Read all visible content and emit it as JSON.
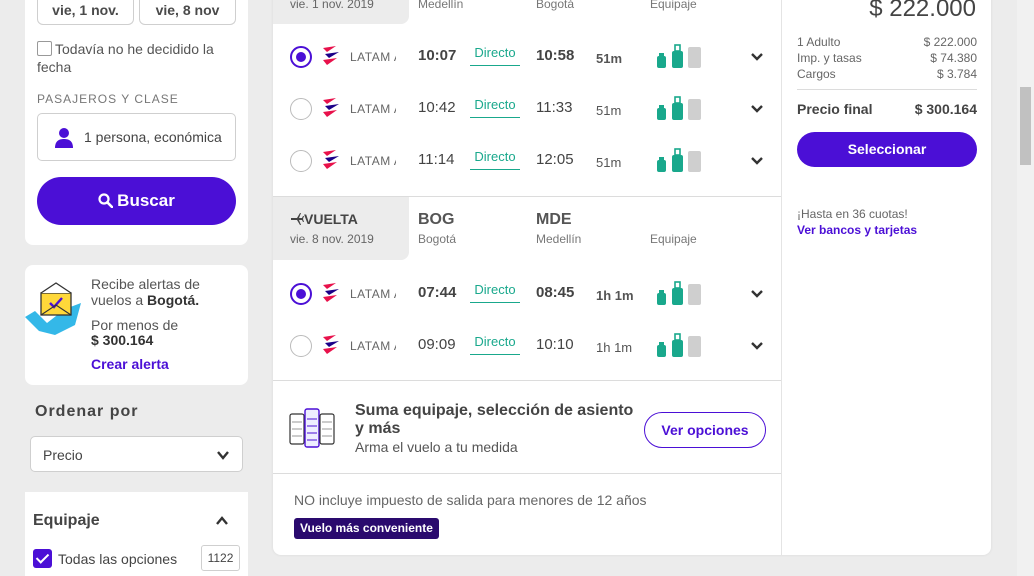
{
  "search": {
    "depart_date": "vie, 1 nov.",
    "return_date": "vie, 8 nov",
    "undecided_label": "Todavía no he decidido la fecha",
    "pax_title": "PASAJEROS Y CLASE",
    "pax_value": "1 persona, económica",
    "search_button": "Buscar"
  },
  "alert": {
    "line1": "Recibe alertas de vuelos a",
    "city": "Bogotá.",
    "under_label": "Por menos de",
    "price": "$ 300.164",
    "link": "Crear alerta"
  },
  "order": {
    "title": "Ordenar por",
    "selected": "Precio"
  },
  "filters": {
    "equip_title": "Equipaje",
    "all_options": "Todas las opciones",
    "all_count": "1122"
  },
  "outbound": {
    "date": "vie. 1 nov. 2019",
    "from_city": "Medellín",
    "to_city": "Bogotá",
    "baggage": "Equipaje",
    "rows": [
      {
        "airline": "LATAM Airlines",
        "dep": "10:07",
        "stops": "Directo",
        "arr": "10:58",
        "dur": "51m"
      },
      {
        "airline": "LATAM Airlines",
        "dep": "10:42",
        "stops": "Directo",
        "arr": "11:33",
        "dur": "51m"
      },
      {
        "airline": "LATAM Airlines",
        "dep": "11:14",
        "stops": "Directo",
        "arr": "12:05",
        "dur": "51m"
      }
    ]
  },
  "inbound": {
    "label": "VUELTA",
    "date": "vie. 8 nov. 2019",
    "from_code": "BOG",
    "from_city": "Bogotá",
    "to_code": "MDE",
    "to_city": "Medellín",
    "baggage": "Equipaje",
    "rows": [
      {
        "airline": "LATAM Airlines",
        "dep": "07:44",
        "stops": "Directo",
        "arr": "08:45",
        "dur": "1h 1m"
      },
      {
        "airline": "LATAM Airlines",
        "dep": "09:09",
        "stops": "Directo",
        "arr": "10:10",
        "dur": "1h 1m"
      }
    ]
  },
  "extras": {
    "title": "Suma equipaje, selección de asiento y más",
    "subtitle": "Arma el vuelo a tu medida",
    "button": "Ver opciones"
  },
  "notice": "NO incluye impuesto de salida para menores de 12 años",
  "badge": "Vuelo más conveniente",
  "price": {
    "total_top": "$ 222.000",
    "adult_label": "1 Adulto",
    "adult_value": "$ 222.000",
    "taxes_label": "Imp. y tasas",
    "taxes_value": "$ 74.380",
    "charges_label": "Cargos",
    "charges_value": "$ 3.784",
    "final_label": "Precio final",
    "final_value": "$ 300.164",
    "select_button": "Seleccionar",
    "quotas": "¡Hasta en 36 cuotas!",
    "banks_link": "Ver bancos y tarjetas"
  },
  "colors": {
    "accent": "#4b0fd6",
    "direct": "#19a88c",
    "badge": "#2a0a6e"
  }
}
